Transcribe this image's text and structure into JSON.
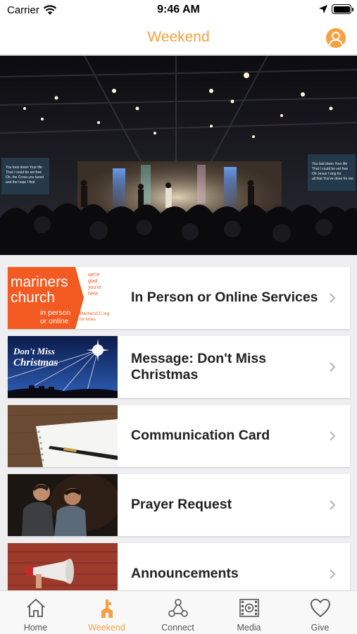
{
  "status_bar": {
    "carrier": "Carrier",
    "time": "9:46 AM"
  },
  "nav": {
    "title": "Weekend",
    "accent_color": "#f6a041"
  },
  "hero": {
    "screen_left_text": "You took down Your life That I could be set free Oh, the Cross you faced and the hope I find",
    "screen_right_text": "You laid down Your life That I could be set free Oh Jesus I sing for all that You've done for me"
  },
  "thumbs": {
    "mariners_line1": "mariners",
    "mariners_line2": "church",
    "mariners_sub1": "in person",
    "mariners_sub2": "or online",
    "mariners_side1": "we're",
    "mariners_side2": "glad",
    "mariners_side3": "you're",
    "mariners_side4": "here",
    "mariners_url": "MarinersCC.org",
    "mariners_url2": "for times",
    "christmas_line1": "Don't Miss",
    "christmas_line2": "Christmas"
  },
  "items": [
    {
      "label": "In Person or Online Services",
      "thumb_icon": "mariners-church-logo"
    },
    {
      "label": "Message: Don't Miss Christmas",
      "thumb_icon": "christmas-star-image"
    },
    {
      "label": "Communication Card",
      "thumb_icon": "notebook-pen-image"
    },
    {
      "label": "Prayer Request",
      "thumb_icon": "praying-people-image"
    },
    {
      "label": "Announcements",
      "thumb_icon": "megaphone-image"
    }
  ],
  "tabs": [
    {
      "label": "Home",
      "icon": "home-icon"
    },
    {
      "label": "Weekend",
      "icon": "weekend-icon"
    },
    {
      "label": "Connect",
      "icon": "connect-icon"
    },
    {
      "label": "Media",
      "icon": "media-icon"
    },
    {
      "label": "Give",
      "icon": "heart-icon"
    }
  ],
  "active_tab": "Weekend"
}
